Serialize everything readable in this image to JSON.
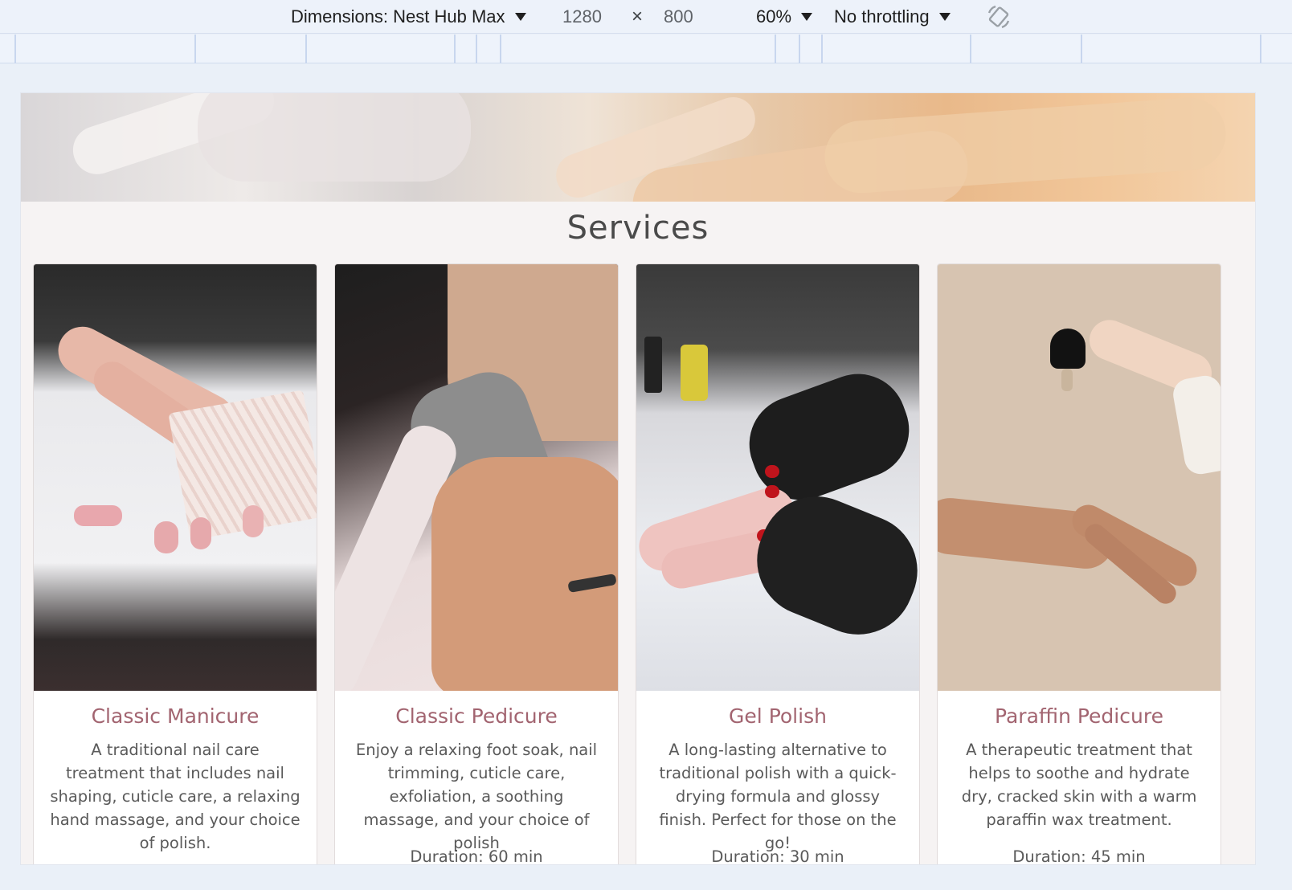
{
  "devtools": {
    "dimensions_label": "Dimensions: Nest Hub Max",
    "width": "1280",
    "times": "×",
    "height": "800",
    "zoom": "60%",
    "throttling": "No throttling",
    "rotate_icon": "rotate-icon"
  },
  "page": {
    "section_title": "Services",
    "services": [
      {
        "title": "Classic Manicure",
        "description": "A traditional nail care treatment that includes nail shaping, cuticle care, a relaxing hand massage, and your choice of polish.",
        "duration": ""
      },
      {
        "title": "Classic Pedicure",
        "description": "Enjoy a relaxing foot soak, nail trimming, cuticle care, exfoliation, a soothing massage, and your choice of polish",
        "duration": "Duration: 60 min"
      },
      {
        "title": "Gel Polish",
        "description": "A long-lasting alternative to traditional polish with a quick-drying formula and glossy finish. Perfect for those on the go!",
        "duration": "Duration: 30 min"
      },
      {
        "title": "Paraffin Pedicure",
        "description": "A therapeutic treatment that helps to soothe and hydrate dry, cracked skin with a warm paraffin wax treatment.",
        "duration": "Duration: 45 min"
      }
    ]
  },
  "colors": {
    "toolbar_bg": "#edf2fa",
    "page_bg": "#f6f3f3",
    "card_title": "#a26470",
    "text": "#5a5a5a"
  }
}
